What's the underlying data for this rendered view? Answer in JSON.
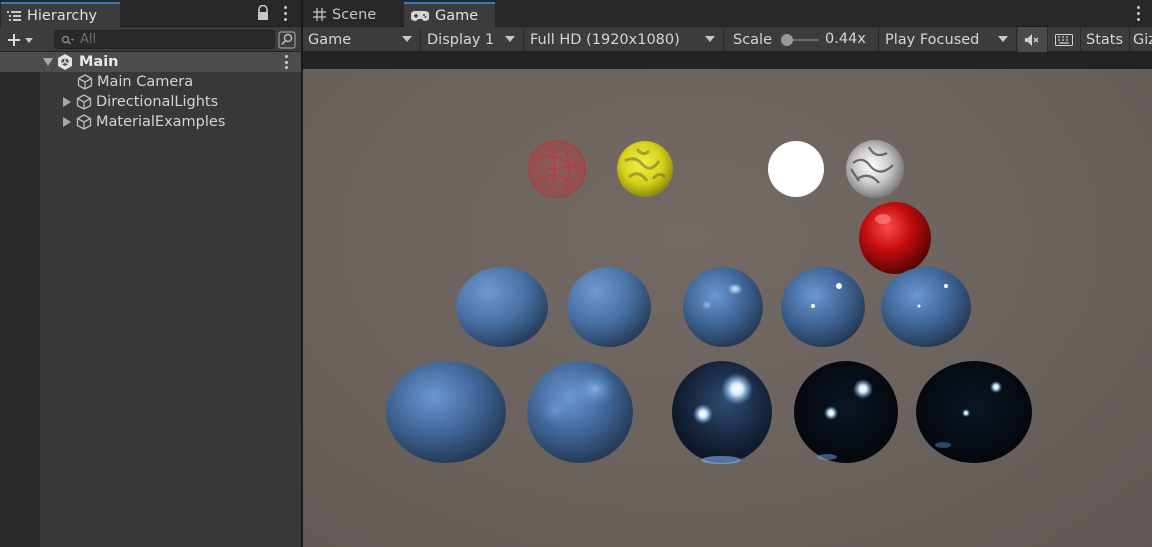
{
  "hierarchy": {
    "tab_label": "Hierarchy",
    "search_placeholder": "All",
    "root": {
      "label": "Main"
    },
    "items": [
      {
        "label": "Main Camera"
      },
      {
        "label": "DirectionalLights"
      },
      {
        "label": "MaterialExamples"
      }
    ]
  },
  "game_view": {
    "tabs": [
      {
        "label": "Scene"
      },
      {
        "label": "Game"
      }
    ],
    "toolbar": {
      "mode": "Game",
      "display": "Display 1",
      "resolution": "Full HD (1920x1080)",
      "scale_label": "Scale",
      "scale_value": "0.44x",
      "play_mode": "Play Focused",
      "stats": "Stats",
      "gizmos": "Gizmos"
    }
  },
  "colors": {
    "accent": "#3a79bb",
    "background_panel": "#383838",
    "viewport_bg": "#6b625d"
  }
}
